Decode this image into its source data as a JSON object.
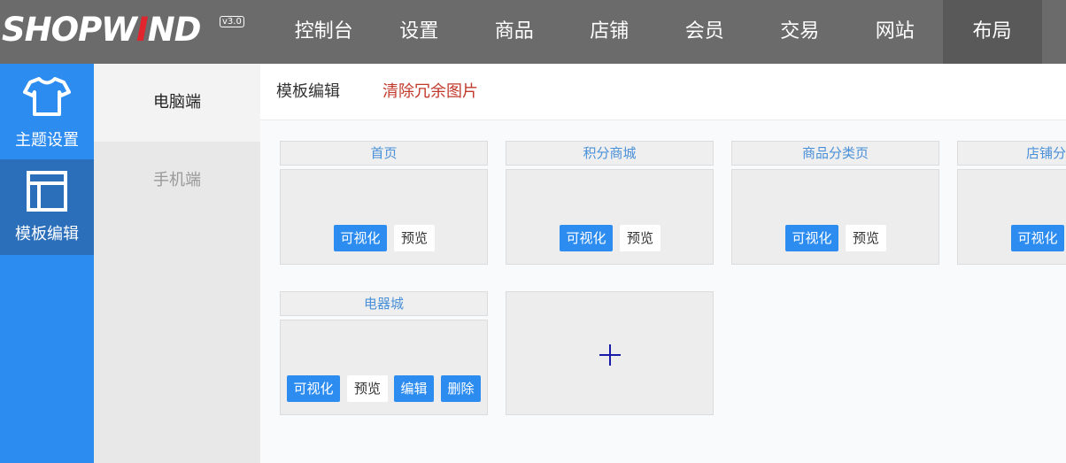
{
  "logo": {
    "text": "SHOPWIND",
    "version": "v3.0"
  },
  "nav": {
    "items": [
      {
        "label": "控制台"
      },
      {
        "label": "设置"
      },
      {
        "label": "商品"
      },
      {
        "label": "店铺"
      },
      {
        "label": "会员"
      },
      {
        "label": "交易"
      },
      {
        "label": "网站"
      },
      {
        "label": "布局",
        "active": true
      }
    ]
  },
  "sidebar": {
    "items": [
      {
        "label": "主题设置",
        "icon": "tshirt-icon"
      },
      {
        "label": "模板编辑",
        "icon": "layout-icon",
        "active": true
      }
    ]
  },
  "subsidebar": {
    "items": [
      {
        "label": "电脑端",
        "active": true
      },
      {
        "label": "手机端"
      }
    ]
  },
  "tabs": {
    "edit": "模板编辑",
    "clear": "清除冗余图片"
  },
  "templates": [
    {
      "title": "首页",
      "visual": "可视化",
      "preview": "预览"
    },
    {
      "title": "积分商城",
      "visual": "可视化",
      "preview": "预览"
    },
    {
      "title": "商品分类页",
      "visual": "可视化",
      "preview": "预览"
    },
    {
      "title": "店铺分",
      "visual": "可视化"
    },
    {
      "title": "电器城",
      "visual": "可视化",
      "preview": "预览",
      "edit": "编辑",
      "delete": "删除"
    }
  ],
  "add_template": {
    "icon": "plus-icon"
  },
  "colors": {
    "accent": "#2d8cf0",
    "topbar": "#6b6b6b",
    "danger": "#c0392b",
    "title": "#4a90d9"
  }
}
